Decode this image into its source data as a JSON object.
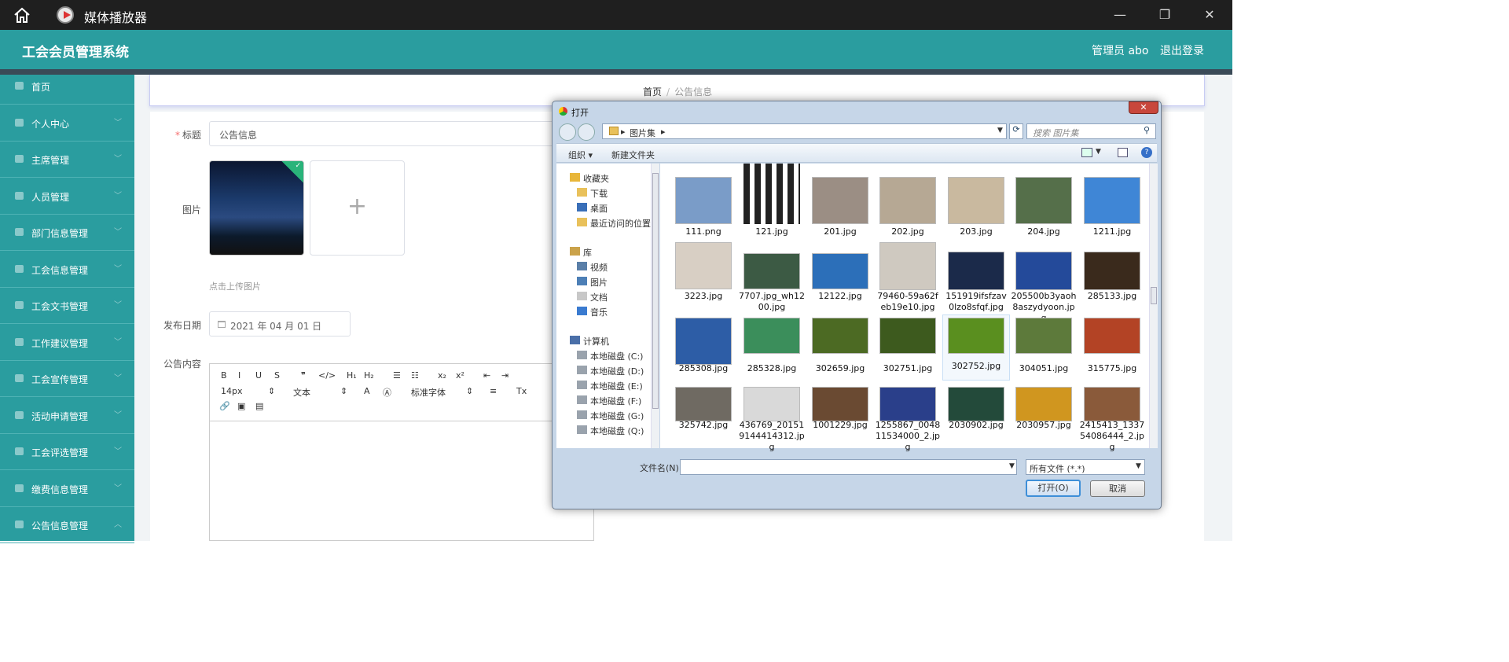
{
  "window": {
    "title": "媒体播放器",
    "controls": [
      "—",
      "❐",
      "✕"
    ]
  },
  "header": {
    "brand": "工会会员管理系统",
    "user": "管理员 abo",
    "logout": "退出登录"
  },
  "sidebar": {
    "items": [
      {
        "label": "首页",
        "icon": "home-icon"
      },
      {
        "label": "个人中心",
        "icon": "user-icon"
      },
      {
        "label": "主席管理",
        "icon": "monitor-icon"
      },
      {
        "label": "人员管理",
        "icon": "monitor-icon"
      },
      {
        "label": "部门信息管理",
        "icon": "card-icon"
      },
      {
        "label": "工会信息管理",
        "icon": "clipboard-icon"
      },
      {
        "label": "工会文书管理",
        "icon": "pen-icon"
      },
      {
        "label": "工作建议管理",
        "icon": "bar-chart-icon"
      },
      {
        "label": "工会宣传管理",
        "icon": "chat-icon"
      },
      {
        "label": "活动申请管理",
        "icon": "list-icon"
      },
      {
        "label": "工会评选管理",
        "icon": "doc-icon"
      },
      {
        "label": "缴费信息管理",
        "icon": "grid-icon"
      },
      {
        "label": "公告信息管理",
        "icon": "chat-icon"
      }
    ]
  },
  "breadcrumb": {
    "home": "首页",
    "separator": "/",
    "current": "公告信息"
  },
  "form": {
    "title_label": "标题",
    "title_value": "公告信息",
    "image_label": "图片",
    "upload_tip": "点击上传图片",
    "upload_plus": "+",
    "date_label": "发布日期",
    "date_value": "2021 年 04 月 01 日",
    "content_label": "公告内容"
  },
  "editor": {
    "row1": [
      "B",
      "I",
      "U",
      "S",
      "❞",
      "</>",
      "H₁",
      "H₂",
      "☰",
      "☷",
      "x₂",
      "x²",
      "⇤",
      "⇥"
    ],
    "font_size": "14px",
    "text_style": "文本",
    "font_family": "标准字体"
  },
  "dialog": {
    "title": "打开",
    "close": "✕",
    "path_root": "▸",
    "path_folder": "图片集",
    "path_tail": "▸",
    "search_placeholder": "搜索 图片集",
    "toolbar": {
      "organize": "组织 ▾",
      "new_folder": "新建文件夹",
      "help": "?"
    },
    "nav": {
      "favorites": "收藏夹",
      "favorites_items": [
        "下载",
        "桌面",
        "最近访问的位置"
      ],
      "library": "库",
      "library_items": [
        "视频",
        "图片",
        "文档",
        "音乐"
      ],
      "computer": "计算机",
      "computer_items": [
        "本地磁盘 (C:)",
        "本地磁盘 (D:)",
        "本地磁盘 (E:)",
        "本地磁盘 (F:)",
        "本地磁盘 (G:)",
        "本地磁盘 (Q:)"
      ]
    },
    "files": [
      {
        "name": "111.png",
        "color": "#7a9cc8"
      },
      {
        "name": "121.jpg",
        "color": "#ffffff"
      },
      {
        "name": "201.jpg",
        "color": "#9b8e84"
      },
      {
        "name": "202.jpg",
        "color": "#b6a894"
      },
      {
        "name": "203.jpg",
        "color": "#c9b99f"
      },
      {
        "name": "204.jpg",
        "color": "#556f4a"
      },
      {
        "name": "1211.jpg",
        "color": "#3f86d6"
      },
      {
        "name": "3223.jpg",
        "color": "#d8cfc4"
      },
      {
        "name": "7707.jpg_wh1200.jpg",
        "color": "#3c5a44"
      },
      {
        "name": "12122.jpg",
        "color": "#2c6fb9"
      },
      {
        "name": "79460-59a62feb19e10.jpg",
        "color": "#cfc9c0"
      },
      {
        "name": "151919ifsfzav0lzo8sfqf.jpg",
        "color": "#1b2a4a"
      },
      {
        "name": "205500b3yaoh8aszydyoon.jpg",
        "color": "#244a9a"
      },
      {
        "name": "285133.jpg",
        "color": "#3a2a1c"
      },
      {
        "name": "285308.jpg",
        "color": "#2d5da6"
      },
      {
        "name": "285328.jpg",
        "color": "#3b8e5b"
      },
      {
        "name": "302659.jpg",
        "color": "#4c6a23"
      },
      {
        "name": "302751.jpg",
        "color": "#3d5a1e"
      },
      {
        "name": "302752.jpg",
        "color": "#5a8f1f"
      },
      {
        "name": "304051.jpg",
        "color": "#5d7a3b"
      },
      {
        "name": "315775.jpg",
        "color": "#b34325"
      },
      {
        "name": "325742.jpg",
        "color": "#6f6a62"
      },
      {
        "name": "436769_201519144414312.jpg",
        "color": "#d9d9d9"
      },
      {
        "name": "1001229.jpg",
        "color": "#6a4a32"
      },
      {
        "name": "1255867_004811534000_2.jpg",
        "color": "#2a3f8a"
      },
      {
        "name": "2030902.jpg",
        "color": "#234a3a"
      },
      {
        "name": "2030957.jpg",
        "color": "#d0961f"
      },
      {
        "name": "2415413_133754086444_2.jpg",
        "color": "#8a5a3a"
      }
    ],
    "filename_label": "文件名(N):",
    "filetype": "所有文件 (*.*)",
    "open": "打开(O)",
    "cancel": "取消"
  }
}
